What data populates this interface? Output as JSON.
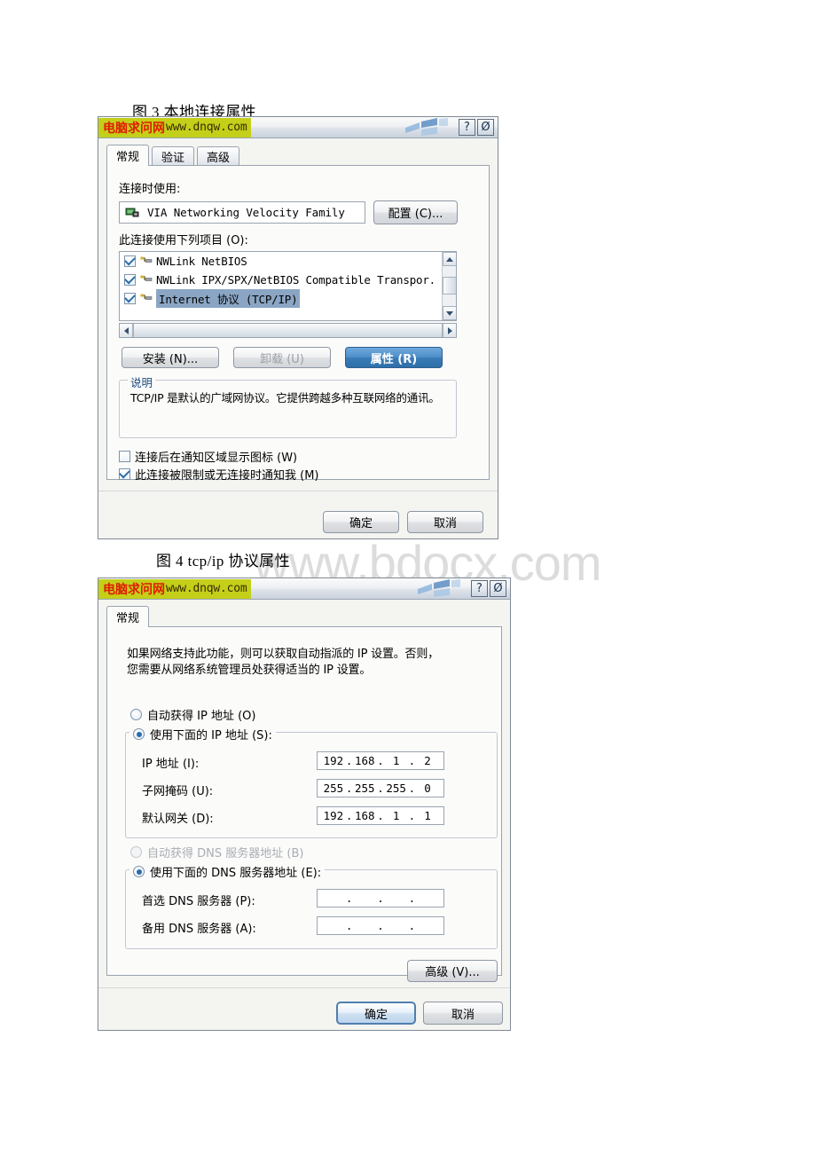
{
  "page": {
    "watermark": "www.bdocx.com",
    "caption_fig3": "图 3 本地连接属性",
    "caption_fig4": "图 4 tcp/ip 协议属性"
  },
  "titlebar": {
    "site_cn": "电脑求问网",
    "site_url": "www.dnqw.com",
    "help_btn": "?",
    "close_btn": "Ø",
    "highlight_color": "#c3cf18",
    "cn_text_color": "#e01b00"
  },
  "lan_dialog": {
    "tabs": [
      {
        "label": "常规",
        "active": true
      },
      {
        "label": "验证",
        "active": false
      },
      {
        "label": "高级",
        "active": false
      }
    ],
    "connect_using_label": "连接时使用:",
    "adapter_name": "VIA Networking Velocity Family",
    "configure_button": "配置 (C)...",
    "items_label": "此连接使用下列项目 (O):",
    "protocols": [
      {
        "name": "NWLink NetBIOS",
        "checked": true,
        "selected": false
      },
      {
        "name": "NWLink IPX/SPX/NetBIOS Compatible Transpor.",
        "checked": true,
        "selected": false
      },
      {
        "name": "Internet 协议 (TCP/IP)",
        "checked": true,
        "selected": true
      }
    ],
    "install_button": "安装 (N)...",
    "uninstall_button": "卸载 (U)",
    "properties_button": "属性 (R)",
    "description_legend": "说明",
    "description_text": "TCP/IP 是默认的广域网协议。它提供跨越多种互联网络的通讯。",
    "checkbox_tray": {
      "label": "连接后在通知区域显示图标 (W)",
      "checked": false
    },
    "checkbox_notify": {
      "label": "此连接被限制或无连接时通知我 (M)",
      "checked": true
    },
    "ok_button": "确定",
    "cancel_button": "取消"
  },
  "tcp_dialog": {
    "tabs": [
      {
        "label": "常规",
        "active": true
      }
    ],
    "intro_line1": "如果网络支持此功能，则可以获取自动指派的 IP 设置。否则，",
    "intro_line2": "您需要从网络系统管理员处获得适当的 IP 设置。",
    "radio_auto_ip": {
      "label": "自动获得 IP 地址 (O)",
      "checked": false
    },
    "radio_manual_ip": {
      "label": "使用下面的 IP 地址 (S):",
      "checked": true
    },
    "fields": [
      {
        "label": "IP 地址 (I):",
        "octets": [
          "192",
          "168",
          "1",
          "2"
        ]
      },
      {
        "label": "子网掩码 (U):",
        "octets": [
          "255",
          "255",
          "255",
          "0"
        ]
      },
      {
        "label": "默认网关 (D):",
        "octets": [
          "192",
          "168",
          "1",
          "1"
        ]
      }
    ],
    "radio_auto_dns": {
      "label": "自动获得 DNS 服务器地址 (B)",
      "checked": false,
      "disabled": true
    },
    "radio_manual_dns": {
      "label": "使用下面的 DNS 服务器地址 (E):",
      "checked": true
    },
    "dns_fields": [
      {
        "label": "首选 DNS 服务器 (P):",
        "octets": [
          "",
          "",
          "",
          ""
        ]
      },
      {
        "label": "备用 DNS 服务器 (A):",
        "octets": [
          "",
          "",
          "",
          ""
        ]
      }
    ],
    "advanced_button": "高级 (V)...",
    "ok_button": "确定",
    "cancel_button": "取消"
  }
}
